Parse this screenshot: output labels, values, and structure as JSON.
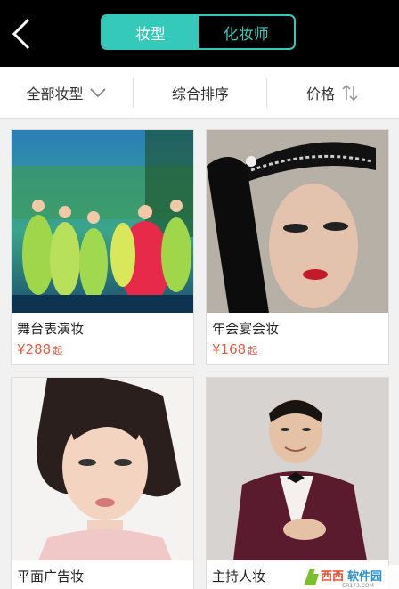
{
  "header": {
    "tabs": [
      {
        "label": "妆型",
        "active": true
      },
      {
        "label": "化妆师",
        "active": false
      }
    ]
  },
  "filter": {
    "category": "全部妆型",
    "sort": "综合排序",
    "price": "价格"
  },
  "items": [
    {
      "name": "舞台表演妆",
      "price": "¥288",
      "unit": "起"
    },
    {
      "name": "年会宴会妆",
      "price": "¥168",
      "unit": "起"
    },
    {
      "name": "平面广告妆",
      "price": "",
      "unit": ""
    },
    {
      "name": "主持人妆",
      "price": "",
      "unit": ""
    }
  ],
  "watermark": {
    "brand": "西西软件园",
    "domain": "CR173.COM"
  },
  "colors": {
    "accent": "#35c9b9",
    "price": "#e35a42"
  }
}
